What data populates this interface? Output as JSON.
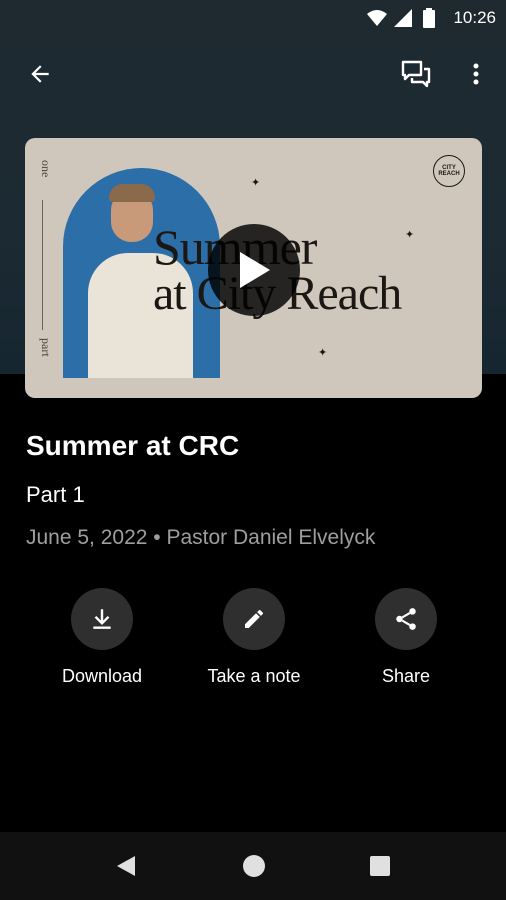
{
  "status_bar": {
    "time": "10:26",
    "icons": [
      "wifi-icon",
      "signal-icon",
      "battery-icon"
    ]
  },
  "app_bar": {
    "icons": [
      "back-arrow-icon",
      "chat-icon",
      "more-vert-icon"
    ]
  },
  "video": {
    "side_top": "one",
    "side_bottom": "part",
    "art_line1": "Summer",
    "art_line2": "at City Reach",
    "logo_text": "CITY REACH",
    "play_icon": "play-icon"
  },
  "sermon": {
    "title": "Summer at CRC",
    "subtitle": "Part 1",
    "meta": "June 5, 2022 • Pastor Daniel Elvelyck"
  },
  "actions": [
    {
      "label": "Download",
      "icon": "download-icon"
    },
    {
      "label": "Take a note",
      "icon": "pencil-icon"
    },
    {
      "label": "Share",
      "icon": "share-icon"
    }
  ],
  "nav_bar": {
    "icons": [
      "nav-back-icon",
      "nav-home-icon",
      "nav-recents-icon"
    ]
  },
  "colors": {
    "background": "#000000",
    "header_bg": "#1c2a33",
    "card_bg": "#d0c7bc",
    "action_circle": "#2f2f2f",
    "meta_text": "#9e9e9e"
  }
}
